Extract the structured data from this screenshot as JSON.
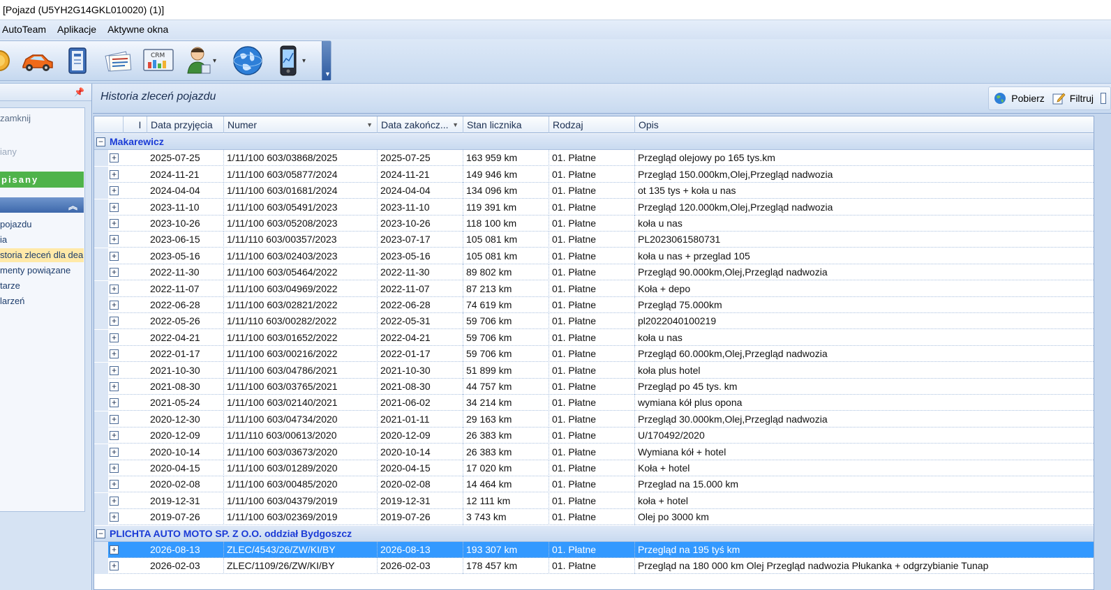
{
  "window": {
    "title": "[Pojazd (U5YH2G14GKL010020) (1)]"
  },
  "menu": {
    "items": [
      "AutoTeam",
      "Aplikacje",
      "Aktywne okna"
    ]
  },
  "toolbar": {
    "icons": [
      "coin-icon",
      "car-icon",
      "phonebook-icon",
      "documents-icon",
      "crm-icon",
      "user-icon",
      "globe-icon",
      "mobile-icon"
    ]
  },
  "left_panel": {
    "close_text": "zamknij",
    "faded_text": "iany",
    "status_label": "pisany",
    "links": [
      "pojazdu",
      "ia",
      "storia zleceń dla dea",
      "menty powiązane",
      "tarze",
      "larzeń"
    ]
  },
  "main": {
    "title": "Historia zleceń pojazdu",
    "actions": {
      "fetch": "Pobierz",
      "filter": "Filtruj"
    }
  },
  "grid": {
    "columns": [
      "I",
      "Data przyjęcia",
      "Numer",
      "Data zakończ...",
      "Stan licznika",
      "Rodzaj",
      "Opis"
    ],
    "groups": [
      {
        "name": "Makarewicz",
        "rows": [
          [
            "2025-07-25",
            "1/11/100 603/03868/2025",
            "2025-07-25",
            "163 959 km",
            "01. Płatne",
            "Przegląd olejowy po 165 tys.km"
          ],
          [
            "2024-11-21",
            "1/11/100 603/05877/2024",
            "2024-11-21",
            "149 946 km",
            "01. Płatne",
            "Przegląd 150.000km,Olej,Przegląd nadwozia"
          ],
          [
            "2024-04-04",
            "1/11/100 603/01681/2024",
            "2024-04-04",
            "134 096 km",
            "01. Płatne",
            "ot 135 tys + koła u nas"
          ],
          [
            "2023-11-10",
            "1/11/100 603/05491/2023",
            "2023-11-10",
            "119 391 km",
            "01. Płatne",
            "Przegląd 120.000km,Olej,Przegląd nadwozia"
          ],
          [
            "2023-10-26",
            "1/11/100 603/05208/2023",
            "2023-10-26",
            "118 100 km",
            "01. Płatne",
            "koła u nas"
          ],
          [
            "2023-06-15",
            "1/11/110 603/00357/2023",
            "2023-07-17",
            "105 081 km",
            "01. Płatne",
            "PL2023061580731"
          ],
          [
            "2023-05-16",
            "1/11/100 603/02403/2023",
            "2023-05-16",
            "105 081 km",
            "01. Płatne",
            "koła u nas + przeglad 105"
          ],
          [
            "2022-11-30",
            "1/11/100 603/05464/2022",
            "2022-11-30",
            "89 802 km",
            "01. Płatne",
            "Przegląd 90.000km,Olej,Przegląd nadwozia"
          ],
          [
            "2022-11-07",
            "1/11/100 603/04969/2022",
            "2022-11-07",
            "87 213 km",
            "01. Płatne",
            "Koła + depo"
          ],
          [
            "2022-06-28",
            "1/11/100 603/02821/2022",
            "2022-06-28",
            "74 619 km",
            "01. Płatne",
            "Przegląd 75.000km"
          ],
          [
            "2022-05-26",
            "1/11/110 603/00282/2022",
            "2022-05-31",
            "59 706 km",
            "01. Płatne",
            "pl2022040100219"
          ],
          [
            "2022-04-21",
            "1/11/100 603/01652/2022",
            "2022-04-21",
            "59 706 km",
            "01. Płatne",
            "koła u nas"
          ],
          [
            "2022-01-17",
            "1/11/100 603/00216/2022",
            "2022-01-17",
            "59 706 km",
            "01. Płatne",
            "Przegląd 60.000km,Olej,Przegląd nadwozia"
          ],
          [
            "2021-10-30",
            "1/11/100 603/04786/2021",
            "2021-10-30",
            "51 899 km",
            "01. Płatne",
            "koła plus hotel"
          ],
          [
            "2021-08-30",
            "1/11/100 603/03765/2021",
            "2021-08-30",
            "44 757 km",
            "01. Płatne",
            "Przegląd po 45 tys. km"
          ],
          [
            "2021-05-24",
            "1/11/100 603/02140/2021",
            "2021-06-02",
            "34 214 km",
            "01. Płatne",
            "wymiana kół plus opona"
          ],
          [
            "2020-12-30",
            "1/11/100 603/04734/2020",
            "2021-01-11",
            "29 163 km",
            "01. Płatne",
            "Przegląd 30.000km,Olej,Przegląd nadwozia"
          ],
          [
            "2020-12-09",
            "1/11/110 603/00613/2020",
            "2020-12-09",
            "26 383 km",
            "01. Płatne",
            "U/170492/2020"
          ],
          [
            "2020-10-14",
            "1/11/100 603/03673/2020",
            "2020-10-14",
            "26 383 km",
            "01. Płatne",
            "Wymiana kół + hotel"
          ],
          [
            "2020-04-15",
            "1/11/100 603/01289/2020",
            "2020-04-15",
            "17 020 km",
            "01. Płatne",
            "Koła + hotel"
          ],
          [
            "2020-02-08",
            "1/11/100 603/00485/2020",
            "2020-02-08",
            "14 464 km",
            "01. Płatne",
            "Przeglad na 15.000 km"
          ],
          [
            "2019-12-31",
            "1/11/100 603/04379/2019",
            "2019-12-31",
            "12 111 km",
            "01. Płatne",
            "koła + hotel"
          ],
          [
            "2019-07-26",
            "1/11/100 603/02369/2019",
            "2019-07-26",
            "3 743 km",
            "01. Płatne",
            "Olej po 3000 km"
          ]
        ]
      },
      {
        "name": "PLICHTA AUTO MOTO SP. Z O.O. oddział Bydgoszcz",
        "rows": [
          [
            "2026-08-13",
            "ZLEC/4543/26/ZW/KI/BY",
            "2026-08-13",
            "193 307 km",
            "01. Płatne",
            "Przegląd na 195 tyś km"
          ],
          [
            "2026-02-03",
            "ZLEC/1109/26/ZW/KI/BY",
            "2026-02-03",
            "178 457 km",
            "01. Płatne",
            "Przegląd na 180 000 km Olej Przegląd nadwozia  Płukanka + odgrzybianie Tunap"
          ]
        ]
      }
    ],
    "selected_row": "2026-08-13"
  },
  "colors": {
    "group_label": "#1a3bd6",
    "selection": "#3399ff",
    "status_green": "#4fb34a"
  }
}
